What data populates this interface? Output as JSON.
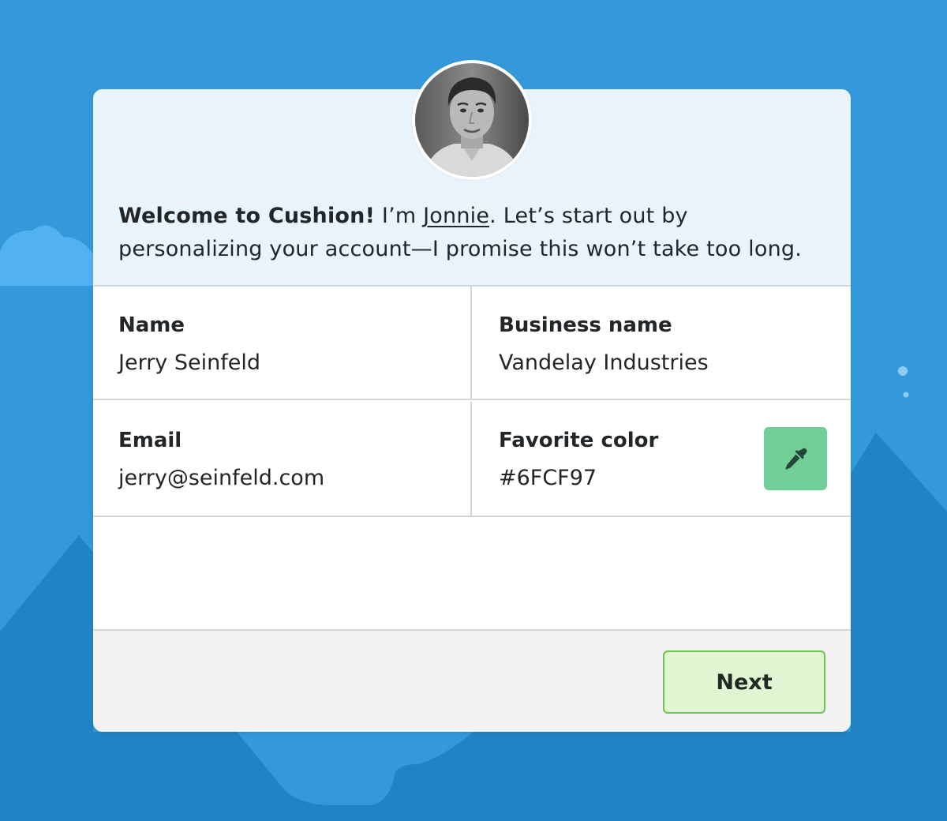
{
  "colors": {
    "background": "#3399da",
    "header_background": "#e8f3fb",
    "favorite_color_swatch": "#6FCF97",
    "next_button_border": "#6cc151",
    "next_button_fill": "#e2f5d3"
  },
  "header": {
    "welcome_bold": "Welcome to Cushion!",
    "intro_prefix": " I’m ",
    "guide_name": "Jonnie",
    "intro_suffix": ". Let’s start out by personalizing your account—I promise this won’t take too long."
  },
  "fields": {
    "name": {
      "label": "Name",
      "value": "Jerry Seinfeld"
    },
    "business_name": {
      "label": "Business name",
      "value": "Vandelay Industries"
    },
    "email": {
      "label": "Email",
      "value": "jerry@seinfeld.com"
    },
    "favorite_color": {
      "label": "Favorite color",
      "value": "#6FCF97",
      "picker_icon": "eyedropper-icon"
    }
  },
  "footer": {
    "next_label": "Next"
  },
  "avatar": {
    "icon": "user-photo"
  }
}
